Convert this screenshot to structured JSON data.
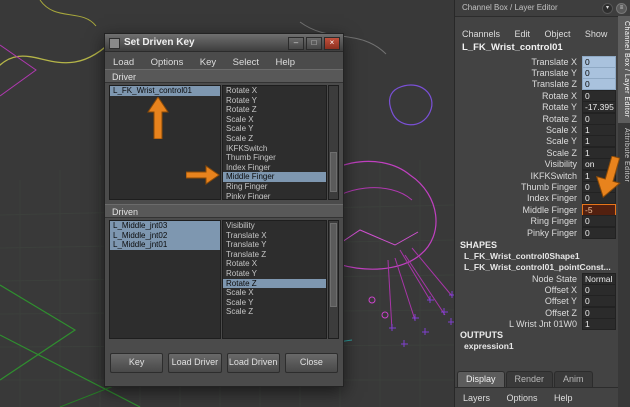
{
  "colors": {
    "accent_orange": "#e8831d",
    "selection_blue": "#7e97b0",
    "value_highlight_blue": "#a9c2dd",
    "value_alert_border": "#e8751a",
    "close_red": "#b0392b"
  },
  "dialog": {
    "title": "Set Driven Key",
    "window_buttons": {
      "minimize": "–",
      "maximize": "□",
      "close": "×"
    },
    "menus": [
      "Load",
      "Options",
      "Key",
      "Select",
      "Help"
    ],
    "driver": {
      "label": "Driver",
      "nodes": [
        {
          "label": "L_FK_Wrist_control01",
          "selected": true
        }
      ],
      "attributes": [
        {
          "label": "Rotate X"
        },
        {
          "label": "Rotate Y"
        },
        {
          "label": "Rotate Z"
        },
        {
          "label": "Scale X"
        },
        {
          "label": "Scale Y"
        },
        {
          "label": "Scale Z"
        },
        {
          "label": "IKFKSwitch"
        },
        {
          "label": "Thumb Finger"
        },
        {
          "label": "Index Finger"
        },
        {
          "label": "Middle Finger",
          "selected": true
        },
        {
          "label": "Ring Finger"
        },
        {
          "label": "Pinky Finger"
        }
      ]
    },
    "driven": {
      "label": "Driven",
      "nodes": [
        {
          "label": "L_Middle_jnt03",
          "selected": true
        },
        {
          "label": "L_Middle_jnt02",
          "selected": true
        },
        {
          "label": "L_Middle_jnt01",
          "selected": true
        }
      ],
      "attributes": [
        {
          "label": "Visibility"
        },
        {
          "label": "Translate X"
        },
        {
          "label": "Translate Y"
        },
        {
          "label": "Translate Z"
        },
        {
          "label": "Rotate X"
        },
        {
          "label": "Rotate Y"
        },
        {
          "label": "Rotate Z",
          "selected": true
        },
        {
          "label": "Scale X"
        },
        {
          "label": "Scale Y"
        },
        {
          "label": "Scale Z"
        }
      ]
    },
    "buttons": [
      "Key",
      "Load Driver",
      "Load Driven",
      "Close"
    ]
  },
  "channel_box": {
    "header": "Channel Box / Layer Editor",
    "menus": [
      "Channels",
      "Edit",
      "Object",
      "Show"
    ],
    "node_name": "L_FK_Wrist_control01",
    "attributes": [
      {
        "label": "Translate X",
        "value": "0",
        "highlight": "blue"
      },
      {
        "label": "Translate Y",
        "value": "0",
        "highlight": "blue"
      },
      {
        "label": "Translate Z",
        "value": "0",
        "highlight": "blue"
      },
      {
        "label": "Rotate X",
        "value": "0"
      },
      {
        "label": "Rotate Y",
        "value": "-17.395"
      },
      {
        "label": "Rotate Z",
        "value": "0"
      },
      {
        "label": "Scale X",
        "value": "1"
      },
      {
        "label": "Scale Y",
        "value": "1"
      },
      {
        "label": "Scale Z",
        "value": "1"
      },
      {
        "label": "Visibility",
        "value": "on"
      },
      {
        "label": "IKFKSwitch",
        "value": "1"
      },
      {
        "label": "Thumb Finger",
        "value": "0"
      },
      {
        "label": "Index Finger",
        "value": "0"
      },
      {
        "label": "Middle Finger",
        "value": "-5",
        "highlight": "orange"
      },
      {
        "label": "Ring Finger",
        "value": "0"
      },
      {
        "label": "Pinky Finger",
        "value": "0"
      }
    ],
    "shapes": {
      "label": "SHAPES",
      "nodes": [
        "L_FK_Wrist_control0Shape1",
        "L_FK_Wrist_control01_pointConst..."
      ],
      "attributes": [
        {
          "label": "Node State",
          "value": "Normal"
        },
        {
          "label": "Offset X",
          "value": "0"
        },
        {
          "label": "Offset Y",
          "value": "0"
        },
        {
          "label": "Offset Z",
          "value": "0"
        },
        {
          "label": "L Wrist Jnt 01W0",
          "value": "1"
        }
      ]
    },
    "outputs": {
      "label": "OUTPUTS",
      "nodes": [
        "expression1"
      ]
    },
    "bottom_tabs": [
      "Display",
      "Render",
      "Anim"
    ],
    "bottom_menus": [
      "Layers",
      "Options",
      "Help"
    ]
  },
  "side_tabs": [
    {
      "label": "Channel Box / Layer Editor",
      "active": true
    },
    {
      "label": "Attribute Editor",
      "active": false
    }
  ]
}
